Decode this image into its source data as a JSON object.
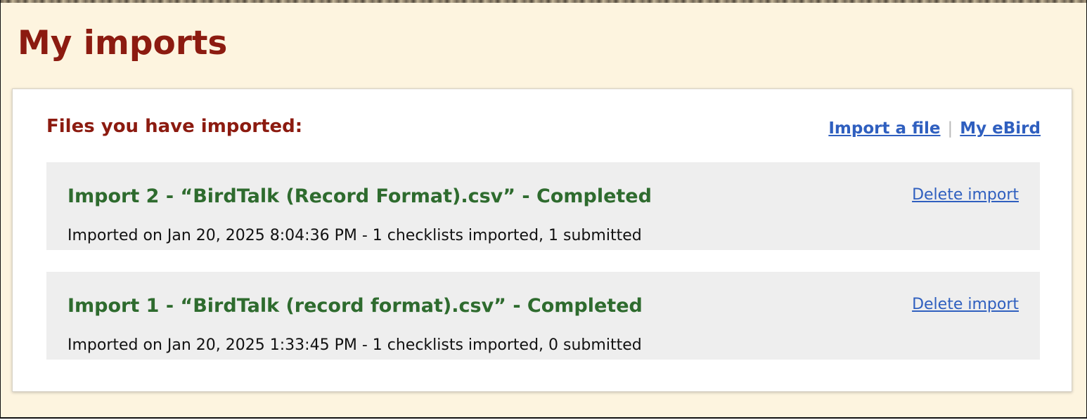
{
  "page": {
    "title": "My imports"
  },
  "panel": {
    "heading": "Files you have imported:",
    "links": {
      "import_file": "Import a file",
      "separator": "|",
      "my_ebird": "My eBird"
    }
  },
  "imports": [
    {
      "title": "Import 2 - “BirdTalk (Record Format).csv” - Completed",
      "meta": "Imported on Jan 20, 2025 8:04:36 PM - 1 checklists imported, 1 submitted",
      "delete_label": "Delete import"
    },
    {
      "title": "Import 1 - “BirdTalk (record format).csv” - Completed",
      "meta": "Imported on Jan 20, 2025 1:33:45 PM - 1 checklists imported, 0 submitted",
      "delete_label": "Delete import"
    }
  ],
  "colors": {
    "page_background": "#fdf4df",
    "title": "#8c1b10",
    "import_title": "#2e6b2e",
    "link": "#2f5fbf",
    "item_background": "#eeeeee"
  }
}
